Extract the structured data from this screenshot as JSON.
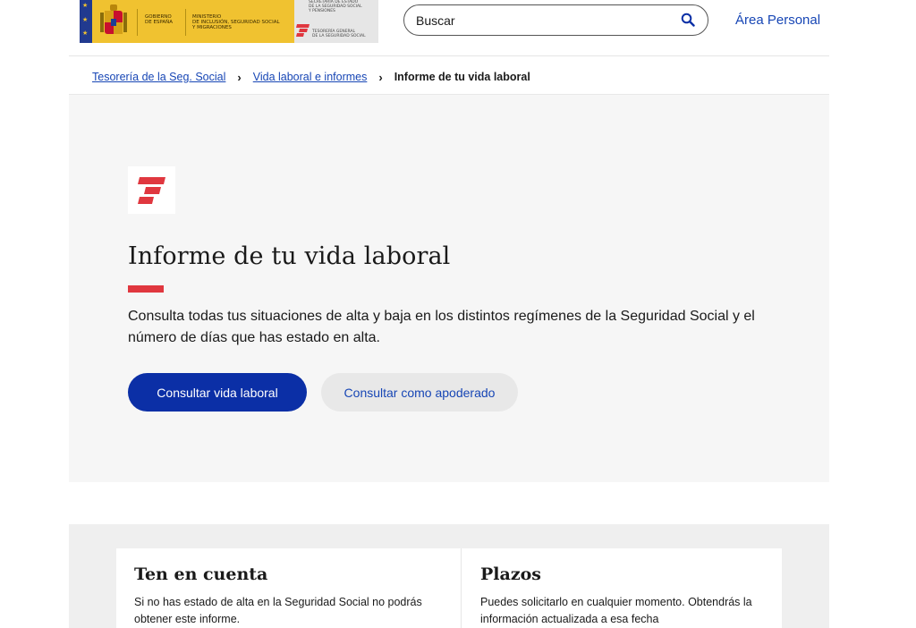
{
  "header": {
    "gov_line1": "GOBIERNO",
    "gov_line2": "DE ESPAÑA",
    "ministry_line1": "MINISTERIO",
    "ministry_line2": "DE INCLUSIÓN, SEGURIDAD SOCIAL",
    "ministry_line3": "Y MIGRACIONES",
    "secretaria_line1": "SECRETARÍA DE ESTADO",
    "secretaria_line2": "DE LA SEGURIDAD SOCIAL",
    "secretaria_line3": "Y PENSIONES",
    "tgss_line1": "TESORERÍA GENERAL",
    "tgss_line2": "DE LA SEGURIDAD SOCIAL",
    "search_label": "Buscar",
    "area_personal": "Área Personal"
  },
  "breadcrumb": {
    "items": [
      {
        "label": "Tesorería de la Seg. Social"
      },
      {
        "label": "Vida laboral e informes"
      }
    ],
    "current": "Informe de tu vida laboral",
    "separator": "›"
  },
  "hero": {
    "title": "Informe de tu vida laboral",
    "description": "Consulta todas tus situaciones de alta y baja en los distintos regímenes de la Seguridad Social y el número de días que has estado en alta.",
    "primary_button": "Consultar vida laboral",
    "secondary_button": "Consultar como apoderado"
  },
  "info": {
    "left_title": "Ten en cuenta",
    "left_text": "Si no has estado de alta en la Seguridad Social no podrás obtener este informe.",
    "right_title": "Plazos",
    "right_text": "Puedes solicitarlo en cualquier momento. Obtendrás la información actualizada a esa fecha"
  },
  "colors": {
    "brand_blue": "#0b2fa6",
    "link_blue": "#1746b5",
    "accent_red": "#e0373f",
    "gov_yellow": "#f0c230"
  }
}
